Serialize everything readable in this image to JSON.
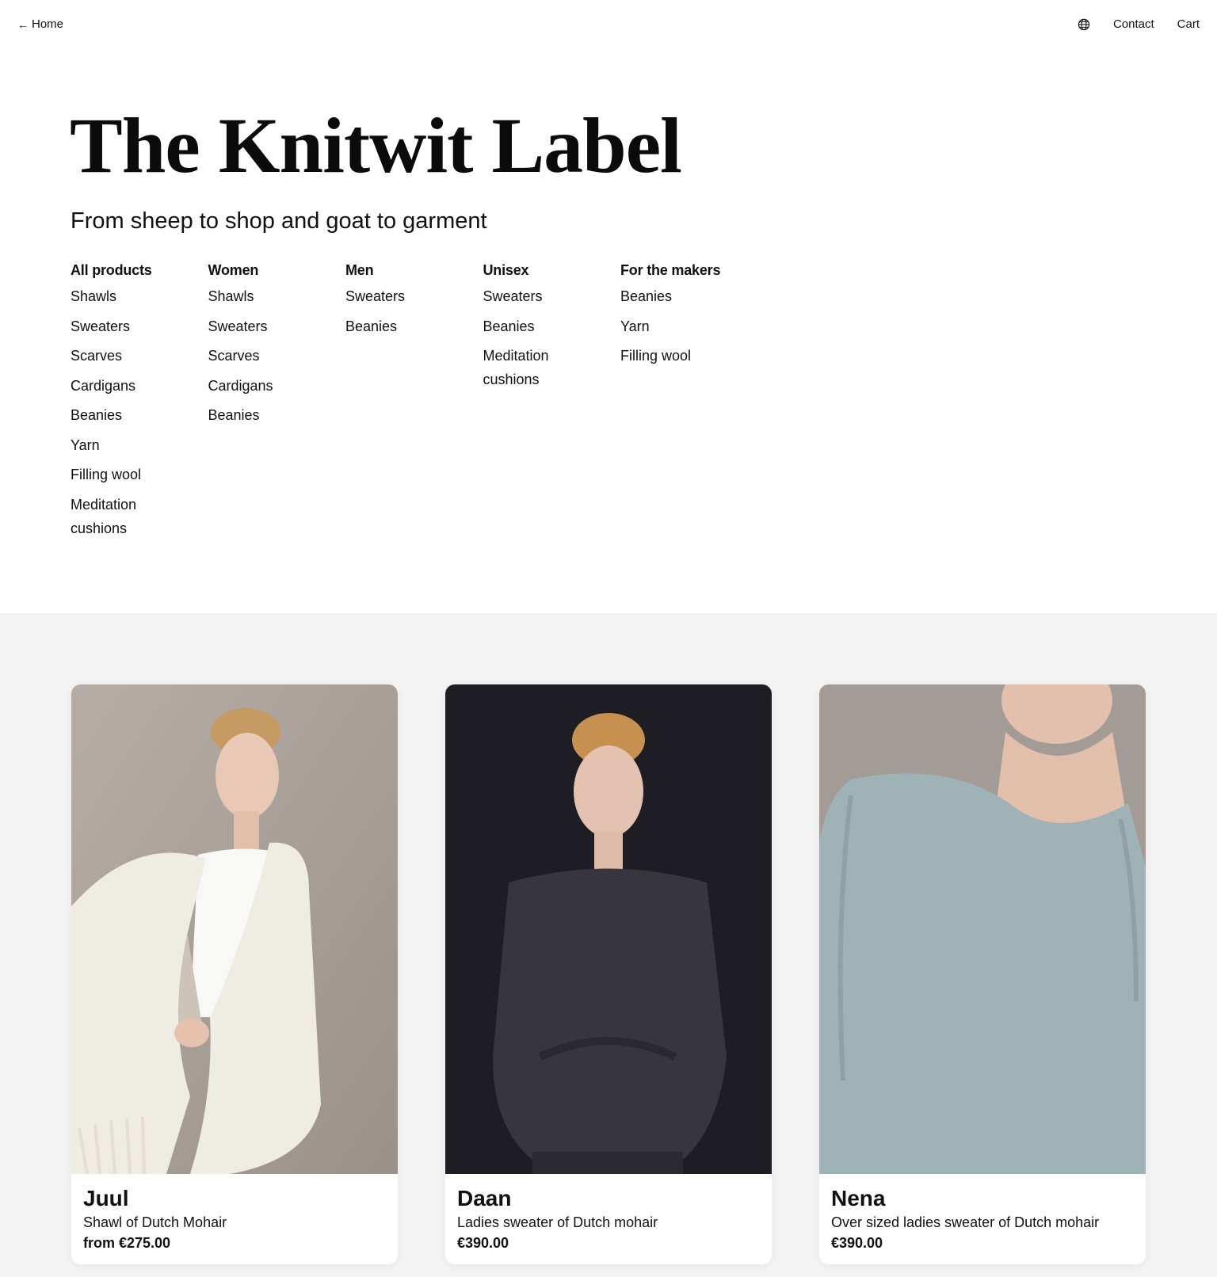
{
  "nav": {
    "home_label": "Home",
    "home_arrow": "←",
    "language_icon": "globe-icon",
    "contact_label": "Contact",
    "cart_label": "Cart"
  },
  "hero": {
    "title": "The Knitwit Label",
    "subtitle": "From sheep to shop and goat to garment"
  },
  "categories": [
    {
      "heading": "All products",
      "items": [
        "Shawls",
        "Sweaters",
        "Scarves",
        "Cardigans",
        "Beanies",
        "Yarn",
        "Filling wool",
        "Meditation cushions"
      ]
    },
    {
      "heading": "Women",
      "items": [
        "Shawls",
        "Sweaters",
        "Scarves",
        "Cardigans",
        "Beanies"
      ]
    },
    {
      "heading": "Men",
      "items": [
        "Sweaters",
        "Beanies"
      ]
    },
    {
      "heading": "Unisex",
      "items": [
        "Sweaters",
        "Beanies",
        "Meditation cushions"
      ]
    },
    {
      "heading": "For the makers",
      "items": [
        "Beanies",
        "Yarn",
        "Filling wool"
      ]
    }
  ],
  "products": [
    {
      "name": "Juul",
      "description": "Shawl of Dutch Mohair",
      "price": "from €275.00",
      "photo_background": "#a59d96",
      "garment_color": "#efece4"
    },
    {
      "name": "Daan",
      "description": "Ladies sweater of Dutch mohair",
      "price": "€390.00",
      "photo_background": "#1e1d23",
      "garment_color": "#37353d"
    },
    {
      "name": "Nena",
      "description": "Over sized ladies sweater of Dutch mohair",
      "price": "€390.00",
      "photo_background": "#a39b95",
      "garment_color": "#9fb3b7"
    }
  ],
  "colors": {
    "text": "#111111",
    "section_background": "#f3f3f3",
    "card_background": "#ffffff"
  }
}
